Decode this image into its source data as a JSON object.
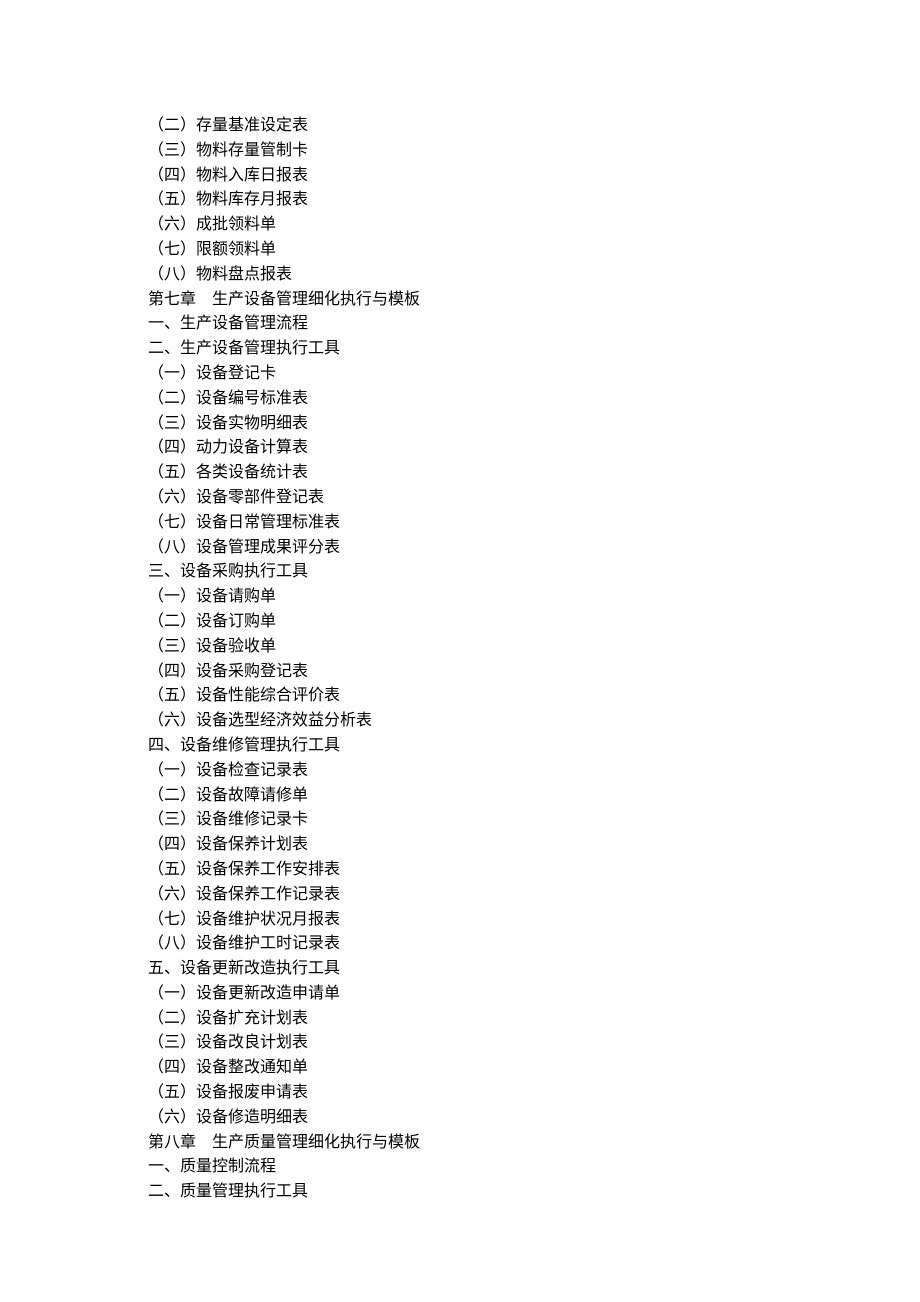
{
  "lines": [
    "（二）存量基准设定表",
    "（三）物料存量管制卡",
    "（四）物料入库日报表",
    "（五）物料库存月报表",
    "（六）成批领料单",
    "（七）限额领料单",
    "（八）物料盘点报表",
    "第七章　生产设备管理细化执行与模板",
    "一、生产设备管理流程",
    "二、生产设备管理执行工具",
    "（一）设备登记卡",
    "（二）设备编号标准表",
    "（三）设备实物明细表",
    "（四）动力设备计算表",
    "（五）各类设备统计表",
    "（六）设备零部件登记表",
    "（七）设备日常管理标准表",
    "（八）设备管理成果评分表",
    "三、设备采购执行工具",
    "（一）设备请购单",
    "（二）设备订购单",
    "（三）设备验收单",
    "（四）设备采购登记表",
    "（五）设备性能综合评价表",
    "（六）设备选型经济效益分析表",
    "四、设备维修管理执行工具",
    "（一）设备检查记录表",
    "（二）设备故障请修单",
    "（三）设备维修记录卡",
    "（四）设备保养计划表",
    "（五）设备保养工作安排表",
    "（六）设备保养工作记录表",
    "（七）设备维护状况月报表",
    "（八）设备维护工时记录表",
    "五、设备更新改造执行工具",
    "（一）设备更新改造申请单",
    "（二）设备扩充计划表",
    "（三）设备改良计划表",
    "（四）设备整改通知单",
    "（五）设备报废申请表",
    "（六）设备修造明细表",
    "第八章　生产质量管理细化执行与模板",
    "一、质量控制流程",
    "二、质量管理执行工具"
  ]
}
